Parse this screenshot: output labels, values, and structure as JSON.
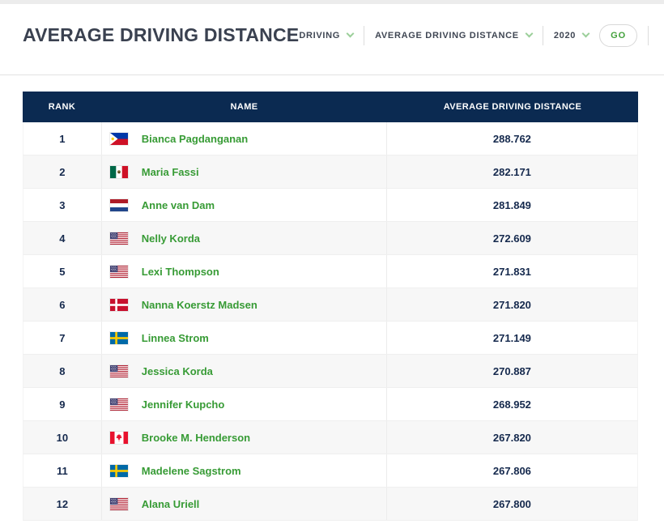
{
  "page": {
    "title": "AVERAGE DRIVING DISTANCE"
  },
  "toolbar": {
    "dropdowns": [
      {
        "label": "DRIVING",
        "icon": "chevron-down-icon"
      },
      {
        "label": "AVERAGE DRIVING DISTANCE",
        "icon": "chevron-down-icon"
      },
      {
        "label": "2020",
        "icon": "chevron-down-icon"
      }
    ],
    "go_label": "GO"
  },
  "table": {
    "columns": [
      "RANK",
      "NAME",
      "AVERAGE DRIVING DISTANCE"
    ],
    "rows": [
      {
        "rank": "1",
        "flag": "PHI",
        "name": "Bianca Pagdanganan",
        "value": "288.762"
      },
      {
        "rank": "2",
        "flag": "MEX",
        "name": "Maria Fassi",
        "value": "282.171"
      },
      {
        "rank": "3",
        "flag": "NED",
        "name": "Anne van Dam",
        "value": "281.849"
      },
      {
        "rank": "4",
        "flag": "USA",
        "name": "Nelly Korda",
        "value": "272.609"
      },
      {
        "rank": "5",
        "flag": "USA",
        "name": "Lexi Thompson",
        "value": "271.831"
      },
      {
        "rank": "6",
        "flag": "DEN",
        "name": "Nanna Koerstz Madsen",
        "value": "271.820"
      },
      {
        "rank": "7",
        "flag": "SWE",
        "name": "Linnea Strom",
        "value": "271.149"
      },
      {
        "rank": "8",
        "flag": "USA",
        "name": "Jessica Korda",
        "value": "270.887"
      },
      {
        "rank": "9",
        "flag": "USA",
        "name": "Jennifer Kupcho",
        "value": "268.952"
      },
      {
        "rank": "10",
        "flag": "CAN",
        "name": "Brooke M. Henderson",
        "value": "267.820"
      },
      {
        "rank": "11",
        "flag": "SWE",
        "name": "Madelene Sagstrom",
        "value": "267.806"
      },
      {
        "rank": "12",
        "flag": "USA",
        "name": "Alana Uriell",
        "value": "267.800"
      }
    ]
  },
  "colors": {
    "table_header_navy": "#0B2A51",
    "rank_value_navy": "#15294D",
    "player_green": "#379B35",
    "go_green": "#43A13C",
    "chevron_green": "#9BCF9A",
    "row_alt_bg": "#F7F7F7",
    "title_color": "#3A4150"
  }
}
